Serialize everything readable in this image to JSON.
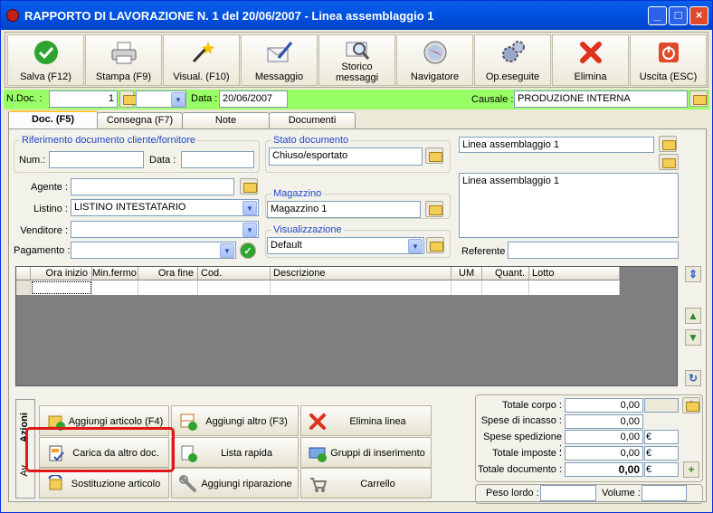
{
  "window": {
    "title": "RAPPORTO DI LAVORAZIONE N. 1  del 20/06/2007 - Linea assemblaggio 1",
    "min": "_",
    "max": "□",
    "close": "×"
  },
  "toolbar": [
    {
      "label": "Salva (F12)",
      "icon": "check-icon"
    },
    {
      "label": "Stampa (F9)",
      "icon": "printer-icon"
    },
    {
      "label": "Visual. (F10)",
      "icon": "magic-wand-icon"
    },
    {
      "label": "Messaggio",
      "icon": "envelope-pen-icon"
    },
    {
      "label": "Storico\nmessaggi",
      "icon": "envelope-search-icon"
    },
    {
      "label": "Navigatore",
      "icon": "compass-icon"
    },
    {
      "label": "Op.eseguite",
      "icon": "gears-icon"
    },
    {
      "label": "Elimina",
      "icon": "red-x-icon"
    },
    {
      "label": "Uscita (ESC)",
      "icon": "power-icon"
    }
  ],
  "header": {
    "ndoc_label": "N.Doc. :",
    "ndoc_value": "1",
    "data_label": "Data :",
    "data_value": "20/06/2007",
    "causale_label": "Causale :",
    "causale_value": "PRODUZIONE INTERNA"
  },
  "tabs": [
    "Doc. (F5)",
    "Consegna (F7)",
    "Note",
    "Documenti"
  ],
  "rif": {
    "title": "Riferimento documento cliente/fornitore",
    "num_label": "Num.:",
    "num_value": "",
    "data_label": "Data :",
    "data_value": ""
  },
  "stato": {
    "title": "Stato documento",
    "value": "Chiuso/esportato"
  },
  "desc": {
    "line1": "Linea assemblaggio 1",
    "memo": "Linea assemblaggio 1",
    "referente_label": "Referente",
    "referente_value": ""
  },
  "fields": {
    "agente_label": "Agente :",
    "agente_value": "",
    "listino_label": "Listino :",
    "listino_value": "LISTINO INTESTATARIO",
    "venditore_label": "Venditore :",
    "venditore_value": "",
    "pagamento_label": "Pagamento :",
    "pagamento_value": ""
  },
  "magazzino": {
    "title": "Magazzino",
    "value": "Magazzino 1"
  },
  "visual": {
    "title": "Visualizzazione",
    "value": "Default"
  },
  "grid": {
    "columns": [
      "Ora inizio",
      "Min.fermo",
      "Ora fine",
      "Cod.",
      "Descrizione",
      "UM",
      "Quant.",
      "Lotto"
    ]
  },
  "actions": {
    "side_tabs": [
      "Azioni",
      "Av"
    ],
    "buttons": [
      {
        "label": "Aggiungi articolo (F4)",
        "icon": "box-add-icon"
      },
      {
        "label": "Aggiungi altro (F3)",
        "icon": "grid-add-icon"
      },
      {
        "label": "Elimina linea",
        "icon": "red-x-icon"
      },
      {
        "label": "Carica da altro doc.",
        "icon": "document-check-icon"
      },
      {
        "label": "Lista rapida",
        "icon": "list-add-icon"
      },
      {
        "label": "Gruppi di inserimento",
        "icon": "boxes-add-icon"
      },
      {
        "label": "Sostituzione articolo",
        "icon": "box-swap-icon"
      },
      {
        "label": "Aggiungi riparazione",
        "icon": "wrench-icon"
      },
      {
        "label": "Carrello",
        "icon": "cart-icon"
      }
    ]
  },
  "totals": {
    "corpo_label": "Totale corpo :",
    "corpo": "0,00",
    "incasso_label": "Spese di incasso :",
    "incasso": "0,00",
    "spedizione_label": "Spese spedizione :",
    "spedizione": "0,00",
    "imposte_label": "Totale imposte :",
    "imposte": "0,00",
    "documento_label": "Totale documento :",
    "documento": "0,00",
    "euro": "€",
    "help": "?",
    "peso_label": "Peso lordo :",
    "volume_label": "Volume :"
  }
}
